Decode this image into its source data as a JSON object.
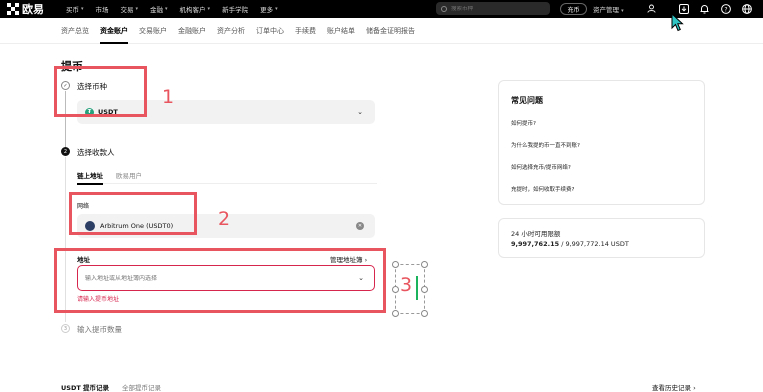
{
  "header": {
    "logo_text": "欧易",
    "nav": [
      "买币",
      "市场",
      "交易",
      "金融",
      "机构客户",
      "新手学院",
      "更多"
    ],
    "search_placeholder": "搜索币种",
    "deposit_button": "充币",
    "asset_mgmt": "资产管理",
    "icons": [
      "user-icon",
      "download-icon",
      "bell-icon",
      "help-icon",
      "globe-icon"
    ]
  },
  "subnav": {
    "items": [
      "资产总览",
      "资金账户",
      "交易账户",
      "金融账户",
      "资产分析",
      "订单中心",
      "手续费",
      "账户结单",
      "储备金证明报告"
    ],
    "active_index": 1
  },
  "main": {
    "title": "提币",
    "step1": {
      "label": "选择币种",
      "coin": "USDT"
    },
    "step2": {
      "num": "2",
      "label": "选择收款人",
      "tabs": [
        "链上地址",
        "欧易用户"
      ],
      "network_label": "网络",
      "network_value": "Arbitrum One (USDT0)",
      "address_label": "地址",
      "manage_link": "管理地址簿 ›",
      "address_placeholder": "输入地址或从地址簿内选择",
      "error": "请输入提币地址"
    },
    "step3": {
      "num": "3",
      "label": "输入提币数量"
    }
  },
  "faq": {
    "title": "常见问题",
    "items": [
      "如何提币?",
      "为什么我提的币一直不到账?",
      "如何选择充币/提币网络?",
      "充提时，如何收取手续费?"
    ]
  },
  "limit": {
    "title": "24 小时可用限额",
    "used": "9,997,762.15",
    "total": " / 9,997,772.14 USDT"
  },
  "bottom": {
    "tabs": [
      "USDT 提币记录",
      "全部提币记录"
    ],
    "history_link": "查看历史记录 ›"
  },
  "annotations": [
    "1",
    "2",
    "3"
  ],
  "colors": {
    "accent_red": "#e8555e",
    "error": "#d7264e",
    "usdt": "#26a17b"
  }
}
